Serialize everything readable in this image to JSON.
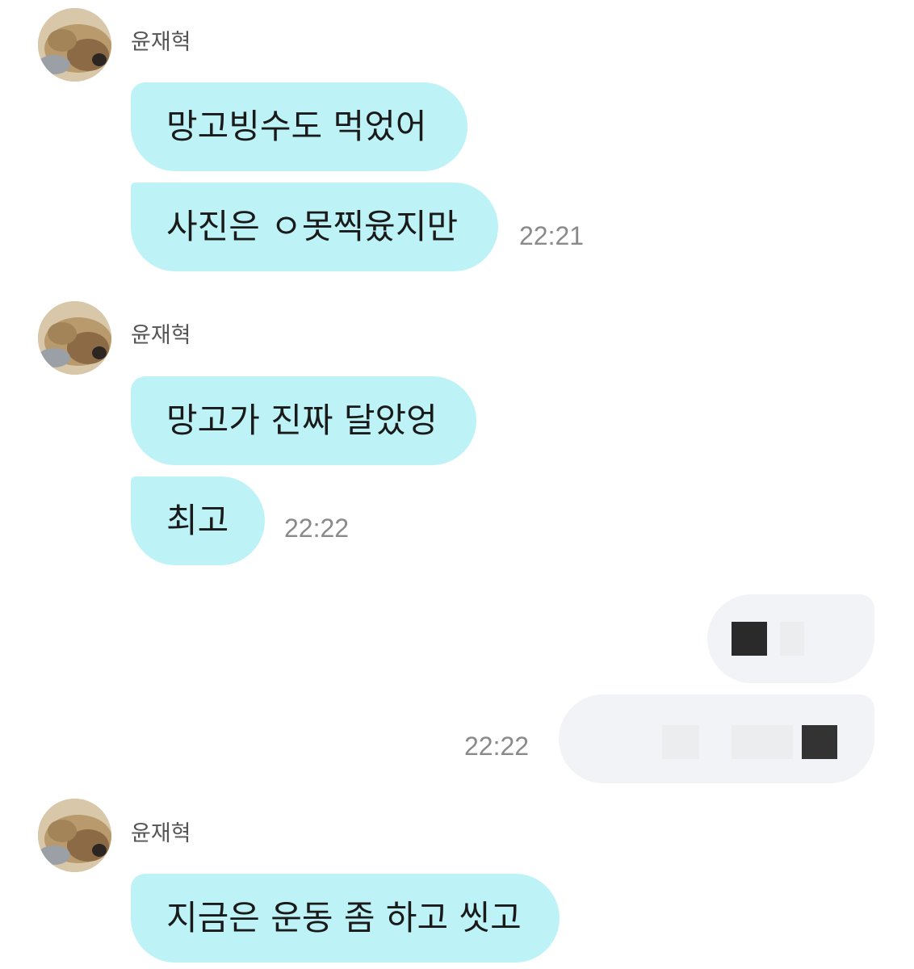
{
  "groups": [
    {
      "sender": "윤재혁",
      "messages": [
        "망고빙수도 먹었어",
        "사진은 ㅇ못찍윴지만"
      ],
      "time": "22:21"
    },
    {
      "sender": "윤재혁",
      "messages": [
        "망고가 진짜 달았엉",
        "최고"
      ],
      "time": "22:22"
    },
    {
      "sender": "윤재혁",
      "messages": [
        "지금은 운동 좀 하고 씻고"
      ],
      "time": ""
    }
  ],
  "outgoing": {
    "time": "22:22",
    "messages_redacted": 2
  },
  "colors": {
    "incoming_bubble": "#bdf3f6",
    "outgoing_bubble": "#f2f3f6",
    "time_text": "#8a8a8a",
    "sender_text": "#555555"
  }
}
